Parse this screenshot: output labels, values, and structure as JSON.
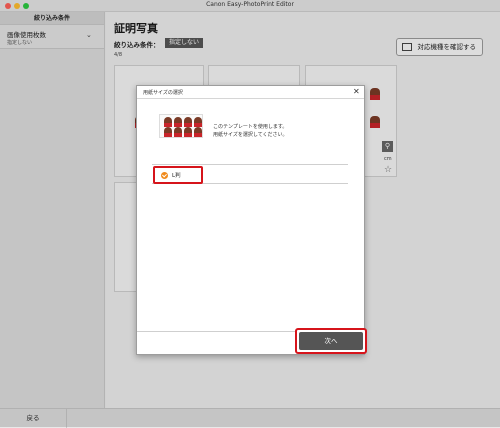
{
  "window": {
    "title": "Canon Easy-PhotoPrint Editor"
  },
  "sidebar": {
    "header": "絞り込み条件",
    "filter": {
      "title": "画像使用枚数",
      "value": "指定しない"
    }
  },
  "main": {
    "title": "証明写真",
    "filter_label": "絞り込み条件：",
    "filter_chip": "指定しない",
    "count": "4/8",
    "check_button": "対応機種を確認する",
    "card_size_suffix": "cm"
  },
  "bottom": {
    "back_label": "戻る"
  },
  "dialog": {
    "title": "用紙サイズの選択",
    "message_line1": "このテンプレートを使用します。",
    "message_line2": "用紙サイズを選択してください。",
    "option_label": "L判",
    "next_label": "次へ"
  },
  "colors": {
    "highlight": "#d6141b",
    "radio": "#f08a1c",
    "button": "#555555"
  }
}
